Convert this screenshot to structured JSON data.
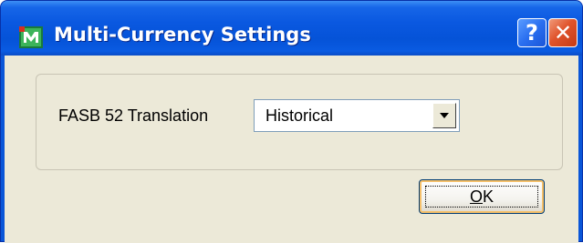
{
  "window": {
    "title": "Multi-Currency Settings",
    "help_label": "?",
    "close_label": "✕"
  },
  "form": {
    "fasb_label": "FASB 52 Translation",
    "fasb_value": "Historical"
  },
  "buttons": {
    "ok_mnemonic": "O",
    "ok_rest": "K"
  },
  "icons": {
    "app": "app-icon",
    "dropdown": "chevron-down-icon"
  },
  "colors": {
    "titlebar": "#0a58e0",
    "client": "#ece9d8",
    "close": "#e0542c"
  }
}
